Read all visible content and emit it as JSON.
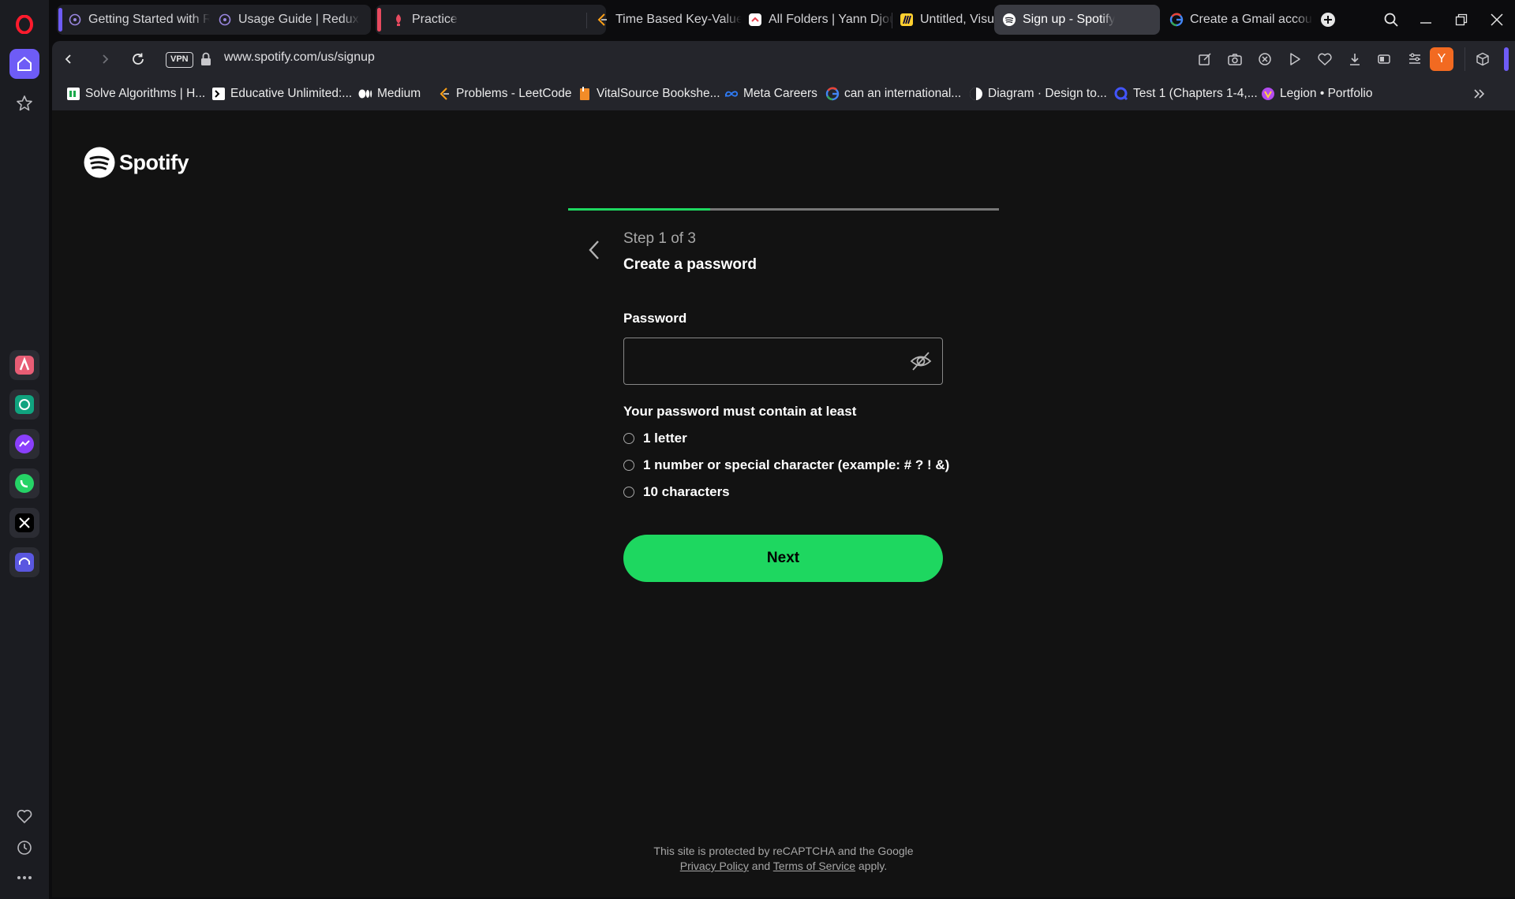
{
  "browser": {
    "tabs": [
      {
        "title": "Getting Started with Re",
        "icon": "redux-icon"
      },
      {
        "title": "Usage Guide | Redux To",
        "icon": "redux-icon"
      },
      {
        "title": "Practice",
        "icon": "practice-icon"
      },
      {
        "title": "Time Based Key-Value S",
        "icon": "leetcode-icon"
      },
      {
        "title": "All Folders | Yann Djoum",
        "icon": "clickup-icon"
      },
      {
        "title": "Untitled, Visual Worksp",
        "icon": "miro-icon"
      },
      {
        "title": "Sign up - Spotify",
        "icon": "spotify-icon",
        "active": true
      },
      {
        "title": "Create a Gmail account",
        "icon": "google-icon"
      }
    ],
    "address": {
      "vpn_label": "VPN",
      "url": "www.spotify.com/us/signup"
    },
    "profile_initial": "Y",
    "bookmarks": [
      {
        "label": "Solve Algorithms | H...",
        "icon": "hackerrank-icon"
      },
      {
        "label": "Educative Unlimited:...",
        "icon": "educative-icon"
      },
      {
        "label": "Medium",
        "icon": "medium-icon"
      },
      {
        "label": "Problems - LeetCode",
        "icon": "leetcode-icon"
      },
      {
        "label": "VitalSource Bookshe...",
        "icon": "vitalsource-icon"
      },
      {
        "label": "Meta Careers",
        "icon": "meta-icon"
      },
      {
        "label": "can an international...",
        "icon": "google-icon"
      },
      {
        "label": "Diagram · Design to...",
        "icon": "diagram-icon"
      },
      {
        "label": "Test 1 (Chapters 1-4,...",
        "icon": "quizlet-icon"
      },
      {
        "label": "Legion • Portfolio",
        "icon": "legion-icon"
      }
    ]
  },
  "colors": {
    "spotify_green": "#1ed760",
    "opera_red": "#ff1b2d",
    "accent_purple": "#6e5cf6"
  },
  "page": {
    "brand": "Spotify",
    "progress": 0.33,
    "step_label": "Step 1 of 3",
    "step_title": "Create a password",
    "password_label": "Password",
    "password_value": "",
    "requirements_heading": "Your password must contain at least",
    "requirements": [
      "1 letter",
      "1 number or special character (example: # ? ! &)",
      "10 characters"
    ],
    "next_label": "Next",
    "footer": {
      "line1": "This site is protected by reCAPTCHA and the Google",
      "privacy": "Privacy Policy",
      "and": "and",
      "terms": "Terms of Service",
      "apply": "apply."
    }
  }
}
